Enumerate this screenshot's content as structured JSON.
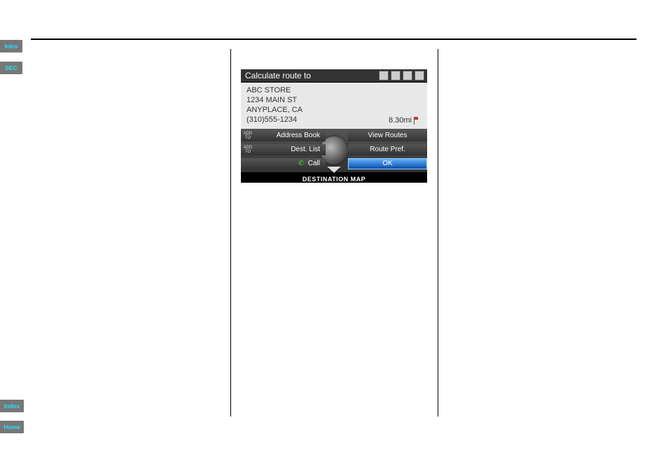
{
  "tabs": {
    "intro": "Intro",
    "sec": "SEC",
    "index": "Index",
    "home": "Home"
  },
  "nav": {
    "title": "Calculate route to",
    "poi_name": "ABC STORE",
    "street": "1234 MAIN ST",
    "city": "ANYPLACE, CA",
    "phone": "(310)555-1234",
    "distance": "8.30mi",
    "addto_pre": "ADD\nTO",
    "opts_left": [
      "Address Book",
      "Dest. List",
      "Call"
    ],
    "opts_right": [
      "View Routes",
      "Route Pref.",
      "OK"
    ],
    "footer": "DESTINATION MAP"
  }
}
